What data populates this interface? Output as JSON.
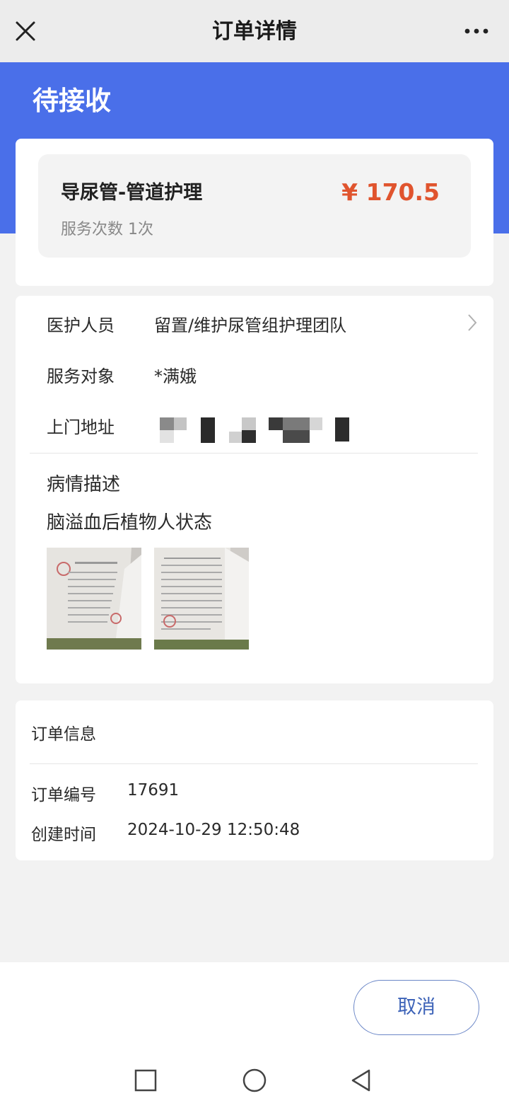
{
  "header": {
    "title": "订单详情"
  },
  "status": {
    "label": "待接收"
  },
  "service": {
    "name": "导尿管-管道护理",
    "count_text": "服务次数 1次",
    "price": "¥ 170.5"
  },
  "info": {
    "staff_label": "医护人员",
    "staff_value": "留置/维护尿管组护理团队",
    "target_label": "服务对象",
    "target_value": "*满娥",
    "address_label": "上门地址",
    "condition_title": "病情描述",
    "condition_desc": "脑溢血后植物人状态"
  },
  "order": {
    "title": "订单信息",
    "number_label": "订单编号",
    "number_value": "17691",
    "created_label": "创建时间",
    "created_value": "2024-10-29 12:50:48"
  },
  "actions": {
    "cancel_label": "取消"
  },
  "colors": {
    "banner": "#4a6fe9",
    "price": "#e0542e",
    "cancel_text": "#3d63b8"
  }
}
